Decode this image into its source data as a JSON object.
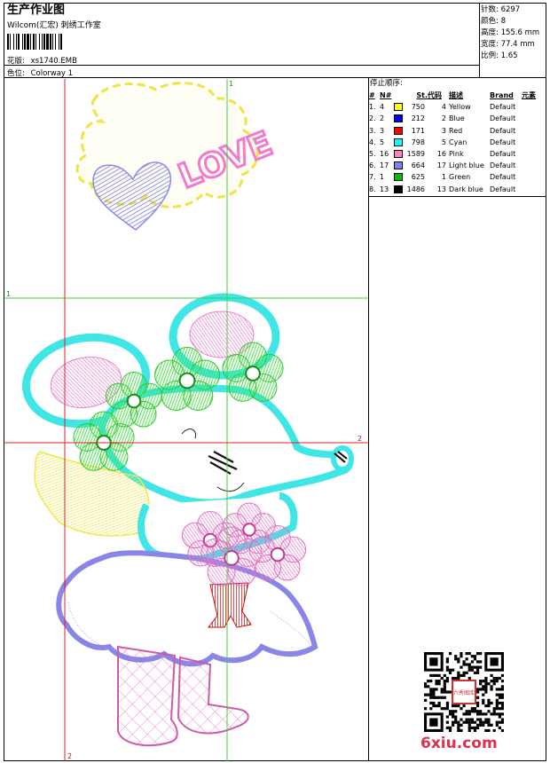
{
  "header": {
    "title": "生产作业图",
    "company": "Wilcom(汇宏) 刺绣工作室",
    "pattern_label": "花版:",
    "pattern_value": "xs1740.EMB",
    "colorway_label": "色位:",
    "colorway_value": "Colorway 1"
  },
  "stats": {
    "stitches_label": "针数:",
    "stitches_value": "6297",
    "colors_label": "颜色:",
    "colors_value": "8",
    "height_label": "高度:",
    "height_value": "155.6 mm",
    "width_label": "宽度:",
    "width_value": "77.4 mm",
    "scale_label": "比例:",
    "scale_value": "1.65"
  },
  "stop_sequence": {
    "label": "停止顺序:",
    "columns": [
      "#",
      "N#",
      "St.",
      "代码",
      "描述",
      "Brand",
      "元素"
    ],
    "rows": [
      {
        "idx": "1.",
        "n": "4",
        "color": "#ffff00",
        "st": "750",
        "code": "4",
        "desc": "Yellow",
        "brand": "Default"
      },
      {
        "idx": "2.",
        "n": "2",
        "color": "#0000ff",
        "st": "212",
        "code": "2",
        "desc": "Blue",
        "brand": "Default"
      },
      {
        "idx": "3.",
        "n": "3",
        "color": "#ff0000",
        "st": "171",
        "code": "3",
        "desc": "Red",
        "brand": "Default"
      },
      {
        "idx": "4.",
        "n": "5",
        "color": "#00ffff",
        "st": "798",
        "code": "5",
        "desc": "Cyan",
        "brand": "Default"
      },
      {
        "idx": "5.",
        "n": "16",
        "color": "#ff80c0",
        "st": "1589",
        "code": "16",
        "desc": "Pink",
        "brand": "Default"
      },
      {
        "idx": "6.",
        "n": "17",
        "color": "#8080ff",
        "st": "664",
        "code": "17",
        "desc": "Light blue",
        "brand": "Default"
      },
      {
        "idx": "7.",
        "n": "1",
        "color": "#00c000",
        "st": "625",
        "code": "1",
        "desc": "Green",
        "brand": "Default"
      },
      {
        "idx": "8.",
        "n": "13",
        "color": "#000000",
        "st": "1486",
        "code": "13",
        "desc": "Dark blue",
        "brand": "Default"
      }
    ]
  },
  "design": {
    "love_text": "LOVE",
    "guide_labels": {
      "v_green": "1",
      "h_green": "1",
      "h_red": "2",
      "v_red": "2"
    }
  },
  "watermark": {
    "text": "6xiu.com",
    "stamp_text": "六秀图库"
  }
}
